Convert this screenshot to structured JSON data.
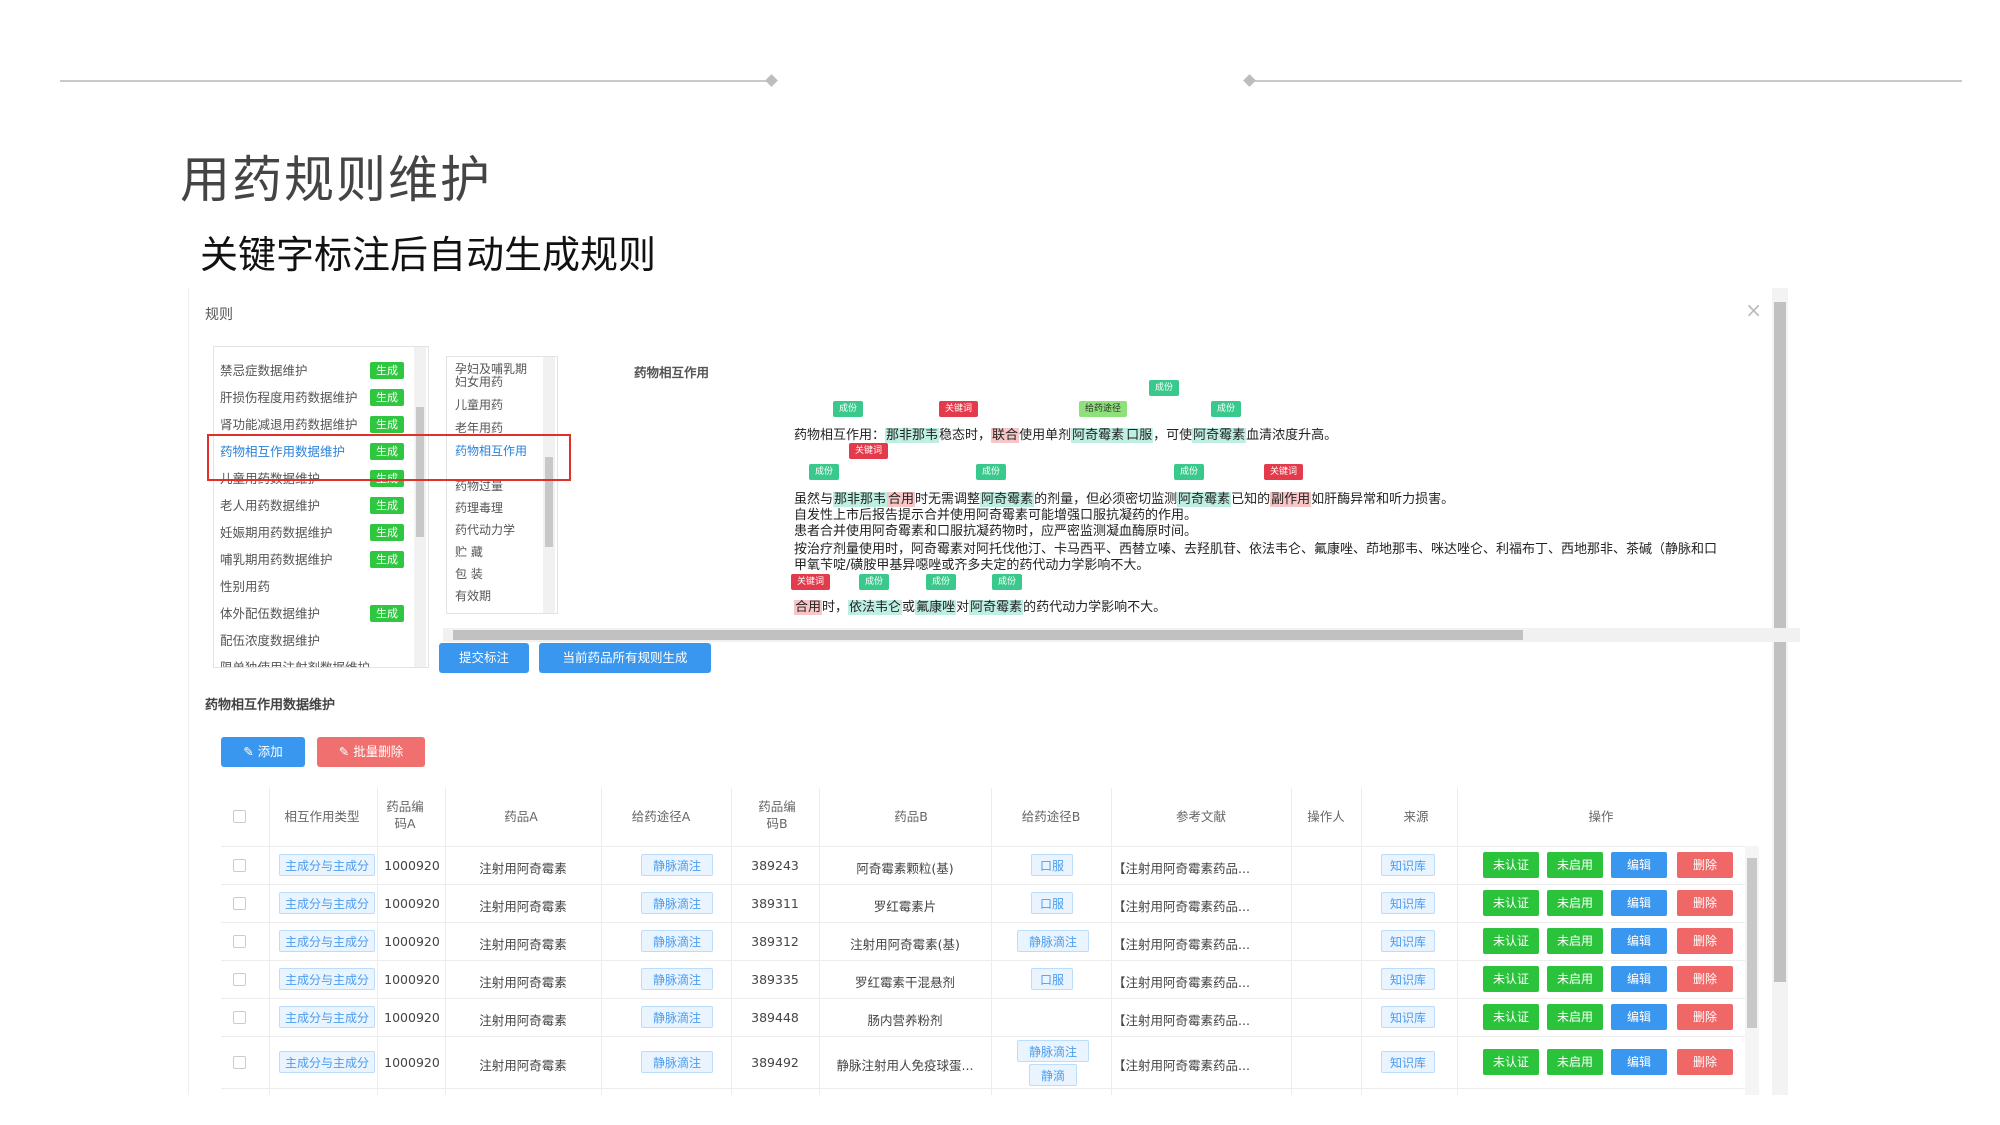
{
  "slide": {
    "title": "用药规则维护",
    "subtitle": "关键字标注后自动生成规则"
  },
  "dialog": {
    "title": "规则",
    "close": "×"
  },
  "rule_list": {
    "generate_label": "生成",
    "items": [
      {
        "label": "禁忌症数据维护",
        "badge": true
      },
      {
        "label": "肝损伤程度用药数据维护",
        "badge": true
      },
      {
        "label": "肾功能减退用药数据维护",
        "badge": true
      },
      {
        "label": "药物相互作用数据维护",
        "badge": true,
        "active": true
      },
      {
        "label": "儿童用药数据维护",
        "badge": true
      },
      {
        "label": "老人用药数据维护",
        "badge": true
      },
      {
        "label": "妊娠期用药数据维护",
        "badge": true
      },
      {
        "label": "哺乳期用药数据维护",
        "badge": true
      },
      {
        "label": "性别用药",
        "badge": false
      },
      {
        "label": "体外配伍数据维护",
        "badge": true
      },
      {
        "label": "配伍浓度数据维护",
        "badge": false
      },
      {
        "label": "限单独使用注射剂数据维护",
        "badge": false
      }
    ]
  },
  "category_list": {
    "items": [
      {
        "label": "孕妇及哺乳期妇女用药"
      },
      {
        "label": "儿童用药"
      },
      {
        "label": "老年用药"
      },
      {
        "label": "药物相互作用",
        "active": true
      },
      {
        "label": "药物过量"
      },
      {
        "label": "药理毒理"
      },
      {
        "label": "药代动力学"
      },
      {
        "label": "贮 藏"
      },
      {
        "label": "包 装"
      },
      {
        "label": "有效期"
      }
    ]
  },
  "annotation": {
    "header": "药物相互作用",
    "tags": {
      "ingredient": "成份",
      "keyword": "关键词",
      "route": "给药途径"
    },
    "line1": {
      "prefix": "药物相互作用：",
      "k1": "那非那韦",
      "t1": "稳态时，",
      "k2": "联合",
      "t2": "使用单剂",
      "k3": "阿奇霉素",
      "k4": "口服",
      "t3": "，可使",
      "k5": "阿奇霉素",
      "t4": "血清浓度升高。"
    },
    "line2": {
      "t0": "虽然与",
      "k1": "那非那韦",
      "k2": "合用",
      "t1": "时无需调整",
      "k3": "阿奇霉素",
      "t2": "的剂量，但必须密切监测",
      "k4": "阿奇霉素",
      "t3": "已知的",
      "k5": "副作用",
      "t4": "如肝酶异常和听力损害。"
    },
    "line3": "自发性上市后报告提示合并使用阿奇霉素可能增强口服抗凝药的作用。",
    "line4": "患者合并使用阿奇霉素和口服抗凝药物时，应严密监测凝血酶原时间。",
    "line5": "按治疗剂量使用时，阿奇霉素对阿托伐他汀、卡马西平、西替立嗪、去羟肌苷、依法韦仑、氟康唑、茚地那韦、咪达唑仑、利福布丁、西地那非、茶碱（静脉和口",
    "line6": "甲氧苄啶/磺胺甲基异噁唑或齐多夫定的药代动力学影响不大。",
    "line7": {
      "k1": "合用",
      "t1": "时，",
      "k2": "依法韦仑",
      "t2": "或",
      "k3": "氟康唑",
      "t3": "对",
      "k4": "阿奇霉素",
      "t4": "的药代动力学影响不大。"
    }
  },
  "buttons": {
    "submit": "提交标注",
    "generate_all": "当前药品所有规则生成",
    "add": "添加",
    "batch_delete": "批量删除"
  },
  "section_title": "药物相互作用数据维护",
  "table": {
    "headers": [
      "相互作用类型",
      "药品编码A",
      "药品A",
      "给药途径A",
      "药品编码B",
      "药品B",
      "给药途径B",
      "参考文献",
      "操作人",
      "来源",
      "操作"
    ],
    "ops": {
      "unverified": "未认证",
      "disabled": "未启用",
      "edit": "编辑",
      "delete": "删除"
    },
    "rows": [
      {
        "type": "主成分与主成分",
        "code_a": "1000920",
        "drug_a": "注射用阿奇霉素",
        "route_a": "静脉滴注",
        "code_b": "389243",
        "drug_b": "阿奇霉素颗粒(基)",
        "route_b": "口服",
        "route_b2": "",
        "ref": "【注射用阿奇霉素药品...",
        "operator": "",
        "source": "知识库"
      },
      {
        "type": "主成分与主成分",
        "code_a": "1000920",
        "drug_a": "注射用阿奇霉素",
        "route_a": "静脉滴注",
        "code_b": "389311",
        "drug_b": "罗红霉素片",
        "route_b": "口服",
        "route_b2": "",
        "ref": "【注射用阿奇霉素药品...",
        "operator": "",
        "source": "知识库"
      },
      {
        "type": "主成分与主成分",
        "code_a": "1000920",
        "drug_a": "注射用阿奇霉素",
        "route_a": "静脉滴注",
        "code_b": "389312",
        "drug_b": "注射用阿奇霉素(基)",
        "route_b": "静脉滴注",
        "route_b2": "",
        "ref": "【注射用阿奇霉素药品...",
        "operator": "",
        "source": "知识库"
      },
      {
        "type": "主成分与主成分",
        "code_a": "1000920",
        "drug_a": "注射用阿奇霉素",
        "route_a": "静脉滴注",
        "code_b": "389335",
        "drug_b": "罗红霉素干混悬剂",
        "route_b": "口服",
        "route_b2": "",
        "ref": "【注射用阿奇霉素药品...",
        "operator": "",
        "source": "知识库"
      },
      {
        "type": "主成分与主成分",
        "code_a": "1000920",
        "drug_a": "注射用阿奇霉素",
        "route_a": "静脉滴注",
        "code_b": "389448",
        "drug_b": "肠内营养粉剂",
        "route_b": "",
        "route_b2": "",
        "ref": "【注射用阿奇霉素药品...",
        "operator": "",
        "source": "知识库"
      },
      {
        "type": "主成分与主成分",
        "code_a": "1000920",
        "drug_a": "注射用阿奇霉素",
        "route_a": "静脉滴注",
        "code_b": "389492",
        "drug_b": "静脉注射用人免疫球蛋...",
        "route_b": "静脉滴注",
        "route_b2": "静滴",
        "ref": "【注射用阿奇霉素药品...",
        "operator": "",
        "source": "知识库"
      }
    ]
  },
  "colors": {
    "primary": "#3a97f0",
    "success": "#2bc23c",
    "danger": "#f06767",
    "highlight_border": "#e0302a"
  }
}
